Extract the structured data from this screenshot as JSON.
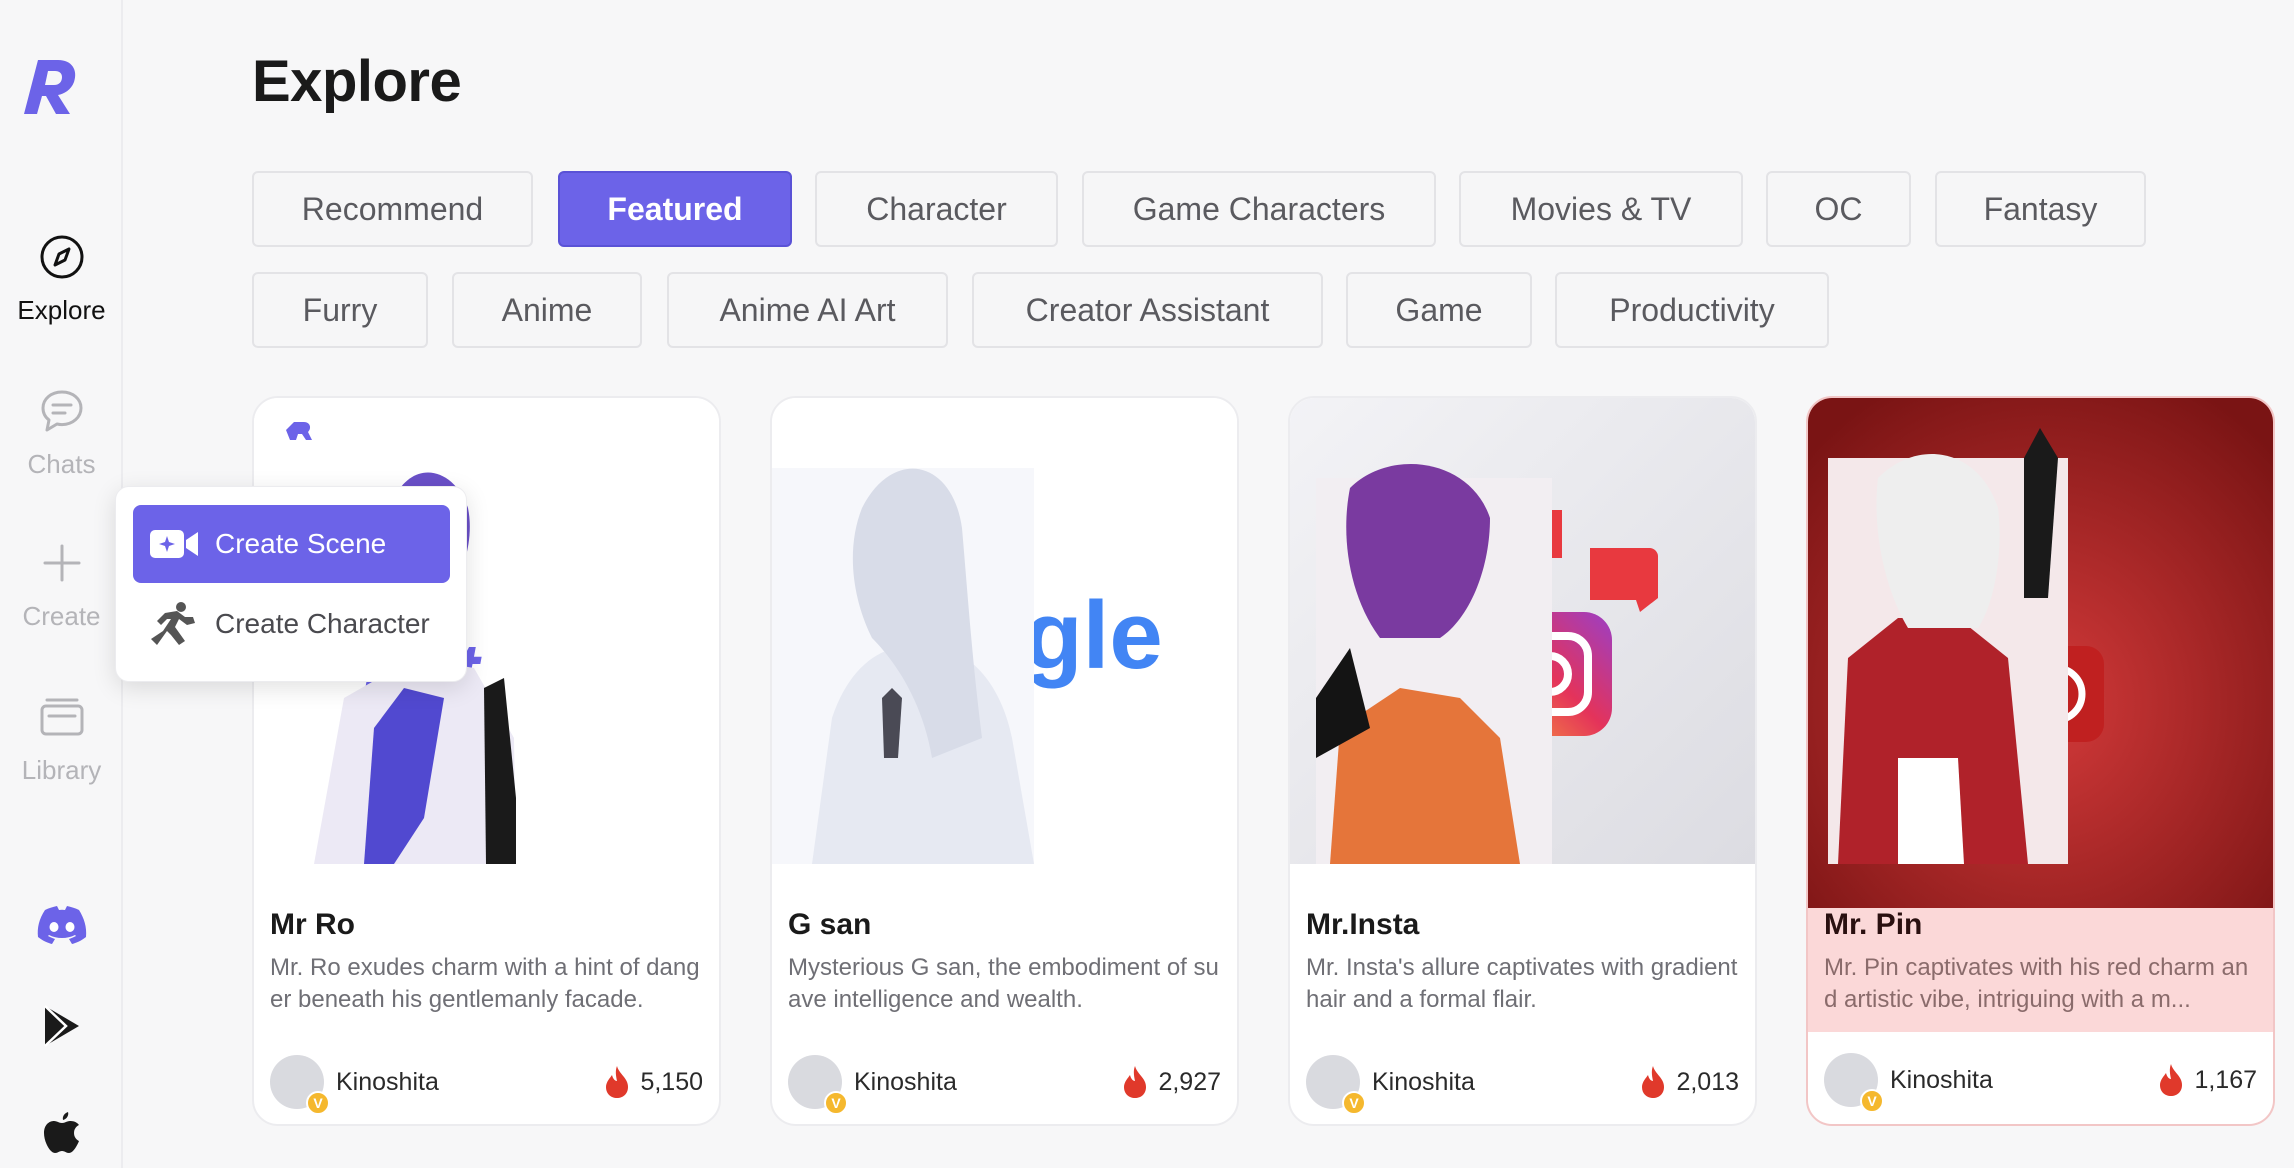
{
  "page": {
    "title": "Explore"
  },
  "sidebar": {
    "explore": "Explore",
    "chats": "Chats",
    "create": "Create",
    "library": "Library"
  },
  "tags": [
    "Recommend",
    "Featured",
    "Character",
    "Game Characters",
    "Movies & TV",
    "OC",
    "Fantasy",
    "Furry",
    "Anime",
    "Anime AI Art",
    "Creator Assistant",
    "Game",
    "Productivity"
  ],
  "active_tag": "Featured",
  "dropdown": {
    "create_scene": "Create Scene",
    "create_character": "Create Character"
  },
  "cards": [
    {
      "name": "Mr Ro",
      "desc": "Mr. Ro exudes charm with a hint of danger beneath his gentlemanly facade.",
      "author": "Kinoshita",
      "count": "5,150",
      "badge": "V",
      "art_text": "hat"
    },
    {
      "name": "G san",
      "desc": "Mysterious G san, the embodiment of suave intelligence and wealth.",
      "author": "Kinoshita",
      "count": "2,927",
      "badge": "V",
      "art_text": "gle"
    },
    {
      "name": "Mr.Insta",
      "desc": "Mr. Insta's allure captivates with gradient hair and a formal flair.",
      "author": "Kinoshita",
      "count": "2,013",
      "badge": "V"
    },
    {
      "name": "Mr. Pin",
      "desc": "Mr. Pin captivates with his red charm and artistic vibe, intriguing with a m...",
      "author": "Kinoshita",
      "count": "1,167",
      "badge": "V"
    }
  ],
  "colors": {
    "accent": "#6c63e8",
    "fire": "#e0392b",
    "badge": "#f5b82e"
  }
}
